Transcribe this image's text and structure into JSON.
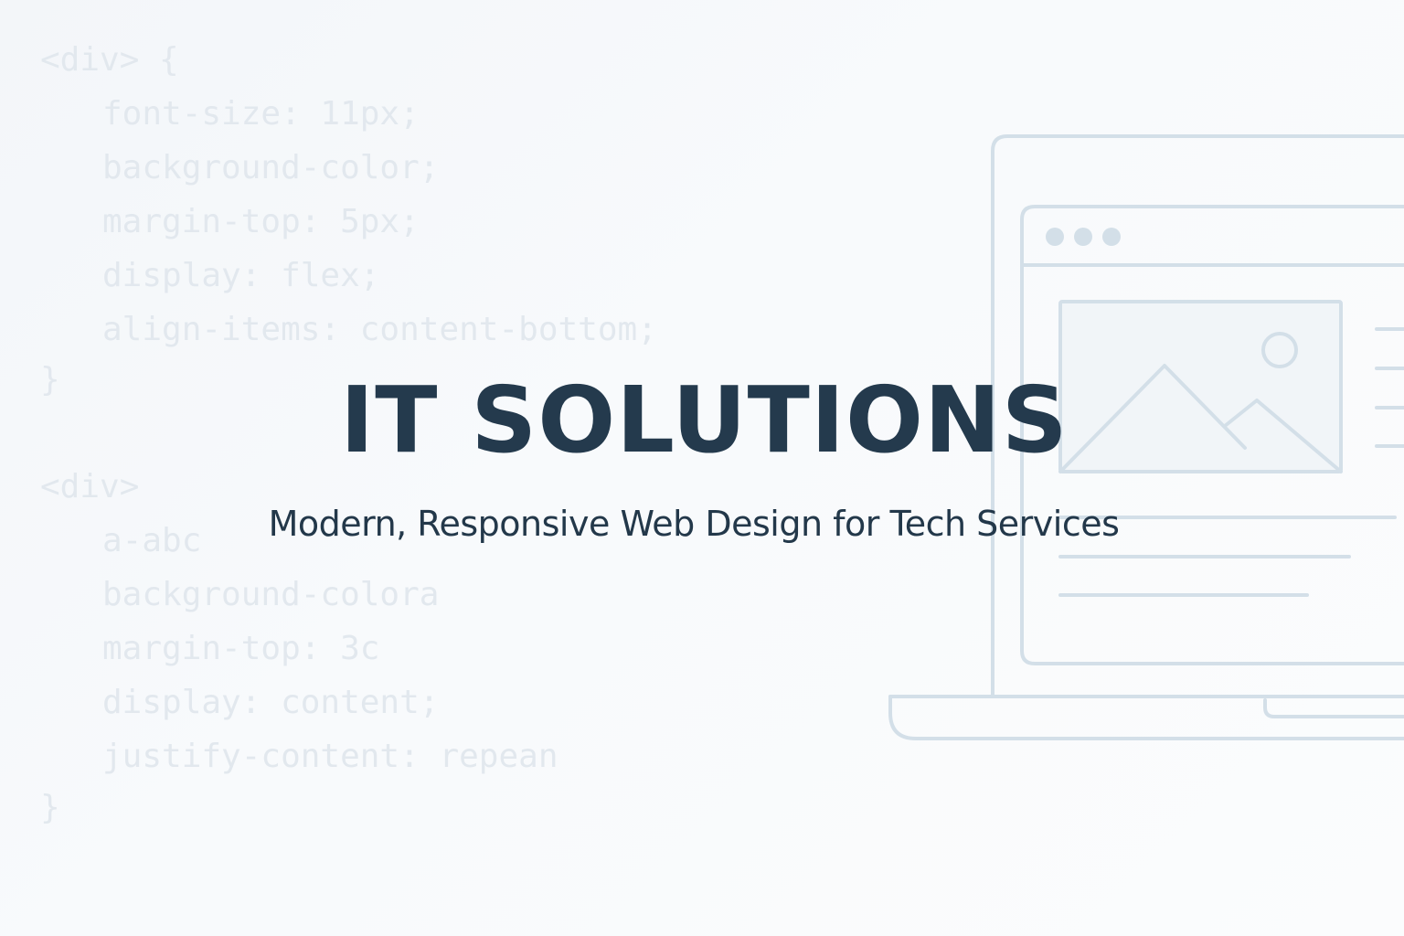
{
  "background_code": [
    "<div> {",
    "font-size: 11px;",
    "background-color;",
    "margin-top: 5px;",
    "display: flex;",
    "align-items: content-bottom;",
    "}",
    "<div>",
    "a-abc",
    "background-colora",
    "margin-top: 3c",
    "display: content;",
    "justify-content: repean",
    "}"
  ],
  "hero": {
    "title": "IT SOLUTIONS",
    "subtitle": "Modern, Responsive Web Design for Tech Services"
  },
  "colors": {
    "background": "#f5f8fa",
    "code_text": "#e2e8ee",
    "title": "#243a4d",
    "subtitle": "#23384a",
    "illustration_stroke": "#d3dfe8"
  },
  "illustration": {
    "icons": [
      "laptop-icon",
      "browser-window-icon",
      "image-placeholder-icon",
      "window-dots-icon"
    ]
  }
}
